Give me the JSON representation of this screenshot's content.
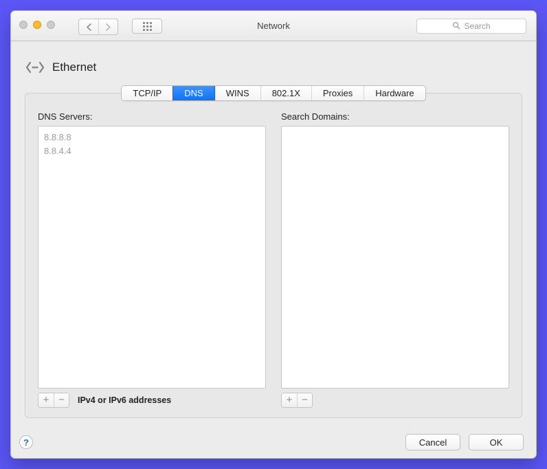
{
  "window": {
    "title": "Network"
  },
  "toolbar": {
    "search_placeholder": "Search"
  },
  "header": {
    "connection_name": "Ethernet"
  },
  "tabs": [
    {
      "id": "tcpip",
      "label": "TCP/IP",
      "selected": false
    },
    {
      "id": "dns",
      "label": "DNS",
      "selected": true
    },
    {
      "id": "wins",
      "label": "WINS",
      "selected": false
    },
    {
      "id": "8021x",
      "label": "802.1X",
      "selected": false
    },
    {
      "id": "proxies",
      "label": "Proxies",
      "selected": false
    },
    {
      "id": "hardware",
      "label": "Hardware",
      "selected": false
    }
  ],
  "dns": {
    "servers_label": "DNS Servers:",
    "servers": [
      "8.8.8.8",
      "8.8.4.4"
    ],
    "domains_label": "Search Domains:",
    "domains": [],
    "hint": "IPv4 or IPv6 addresses"
  },
  "buttons": {
    "cancel": "Cancel",
    "ok": "OK",
    "help_glyph": "?",
    "plus": "+",
    "minus": "−"
  }
}
